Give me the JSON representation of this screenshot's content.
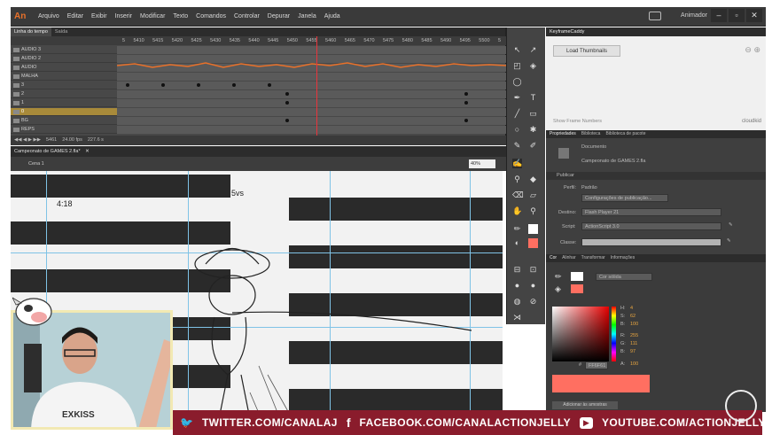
{
  "app": {
    "logo": "An",
    "menu": [
      "Arquivo",
      "Editar",
      "Exibir",
      "Inserir",
      "Modificar",
      "Texto",
      "Comandos",
      "Controlar",
      "Depurar",
      "Janela",
      "Ajuda"
    ],
    "workspace": "Animador",
    "window_buttons": [
      "–",
      "▫",
      "✕"
    ]
  },
  "timeline": {
    "tabs": [
      "Linha do tempo",
      "Saída"
    ],
    "ruler": [
      "5",
      "5410",
      "5415",
      "5420",
      "5425",
      "5430",
      "5435",
      "5440",
      "5445",
      "5450",
      "5455",
      "5460",
      "5465",
      "5470",
      "5475",
      "5480",
      "5485",
      "5490",
      "5495",
      "5500",
      "5"
    ],
    "layers": [
      "AUDIO 3",
      "AUDIO 2",
      "AUDIO",
      "MALHA",
      "3",
      "2",
      "1",
      "0",
      "BG",
      "REPS"
    ],
    "selected_layer": "0",
    "fps": "24.00 fps",
    "time": "227.6 s",
    "current_frame": "5461"
  },
  "stage": {
    "doc_tab": "Campeonato de GAMES 2.fla*",
    "scene": "Cena 1",
    "zoom": "40%",
    "text_time": "4:18",
    "text_vs": "5vs"
  },
  "keyframe_panel": {
    "title": "KeyframeCaddy",
    "button": "Load Thumbnails",
    "show_frame": "Show Frame Numbers",
    "logo": "cloudkid"
  },
  "properties": {
    "tabs": [
      "Propriedades",
      "Biblioteca",
      "Biblioteca de pacote"
    ],
    "doc_label": "Documento",
    "doc_name": "Campeonato de GAMES 2.fla",
    "section": "Publicar",
    "profile_label": "Perfil:",
    "profile_value": "Padrão",
    "publish_settings": "Configurações de publicação...",
    "target_label": "Destino:",
    "target_value": "Flash Player 21",
    "script_label": "Script:",
    "script_value": "ActionScript 3.0",
    "class_label": "Classe:"
  },
  "color": {
    "tabs": [
      "Cor",
      "Alinhar",
      "Transformar",
      "Informações"
    ],
    "fill_type": "Cor sólida",
    "hex": "FF6F61",
    "h_label": "H:",
    "h_value": "4",
    "s_label": "S:",
    "s_value": "62",
    "b_label": "B:",
    "b_value": "100",
    "r_label": "R:",
    "r_value": "255",
    "g_label": "G:",
    "g_value": "111",
    "bl_label": "B:",
    "bl_value": "97",
    "a_label": "A:",
    "a_value": "100",
    "add_swatch": "Adicionar às amostras",
    "swatch_color": "#ff6f61"
  },
  "webcam": {
    "shirt_text": "EXKISS"
  },
  "banner": {
    "twitter": "TWITTER.COM/CANALAJ",
    "facebook": "FACEBOOK.COM/CANALACTIONJELLY",
    "youtube": "YOUTUBE.COM/ACTIONJELLY",
    "bg_color": "#8a1c2c"
  }
}
